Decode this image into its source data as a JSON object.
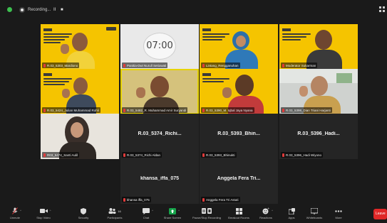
{
  "topbar": {
    "recording_label": "Recording...",
    "pause_label": "II",
    "stop_label": "■",
    "view_icon": "grid-view-icon"
  },
  "timer": {
    "time": "07:00"
  },
  "participants": [
    {
      "name": "R.03_5303_Mardiono"
    },
    {
      "name": "Panitia-Dwi Nurull Setiowati"
    },
    {
      "name": "Lintang_Rengganuhan"
    },
    {
      "name": "Moderator Sukarman"
    },
    {
      "name": "R.03_5424_Julian Muhammad Rohli"
    },
    {
      "name": "R.03_5482_R. Muhammad Amir Suryandi"
    },
    {
      "name": "R.03_5390_M. Iqbal Jaya Nyana"
    },
    {
      "name": "R.03_5398_Dian Triani Harjanti"
    },
    {
      "name": "R03_5474_Santi Aulil"
    },
    {
      "name": "R.03_5374_Richi Aldan",
      "display": "R.03_5374_Richi..."
    },
    {
      "name": "R.03_5393_Bhinukti",
      "display": "R.03_5393_Bhin..."
    },
    {
      "name": "R.03_5396_Hadi Wiyono",
      "display": "R.03_5396_Hadi..."
    },
    {
      "name": "khansa iffa_075",
      "display": "khansa_iffa_075"
    },
    {
      "name": "Anggela Fera Tri Astuti",
      "display": "Anggela Fera Tri..."
    }
  ],
  "toolbar": {
    "items": [
      {
        "label": "Unmute",
        "icon": "mic-muted-icon"
      },
      {
        "label": "Stop Video",
        "icon": "video-camera-icon"
      },
      {
        "label": "Security",
        "icon": "shield-icon"
      },
      {
        "label": "Participants",
        "icon": "participants-icon",
        "count": "16"
      },
      {
        "label": "Chat",
        "icon": "chat-icon"
      },
      {
        "label": "Share Screen",
        "icon": "share-screen-icon"
      },
      {
        "label": "Pause/Stop Recording",
        "icon": "recording-icon"
      },
      {
        "label": "Breakout Rooms",
        "icon": "breakout-rooms-icon"
      },
      {
        "label": "Reactions",
        "icon": "reactions-icon"
      },
      {
        "label": "Apps",
        "icon": "apps-icon"
      },
      {
        "label": "Whiteboards",
        "icon": "whiteboard-icon"
      },
      {
        "label": "More",
        "icon": "more-icon"
      }
    ],
    "leave_label": "Leave"
  },
  "colors": {
    "background": "#1a1a1a",
    "tile": "#2b2b2b",
    "poster_yellow": "#f5c400",
    "active_speaker": "#e7d300",
    "muted_red": "#e13b3b",
    "share_green": "#16a34a",
    "leave_red": "#e02828"
  }
}
